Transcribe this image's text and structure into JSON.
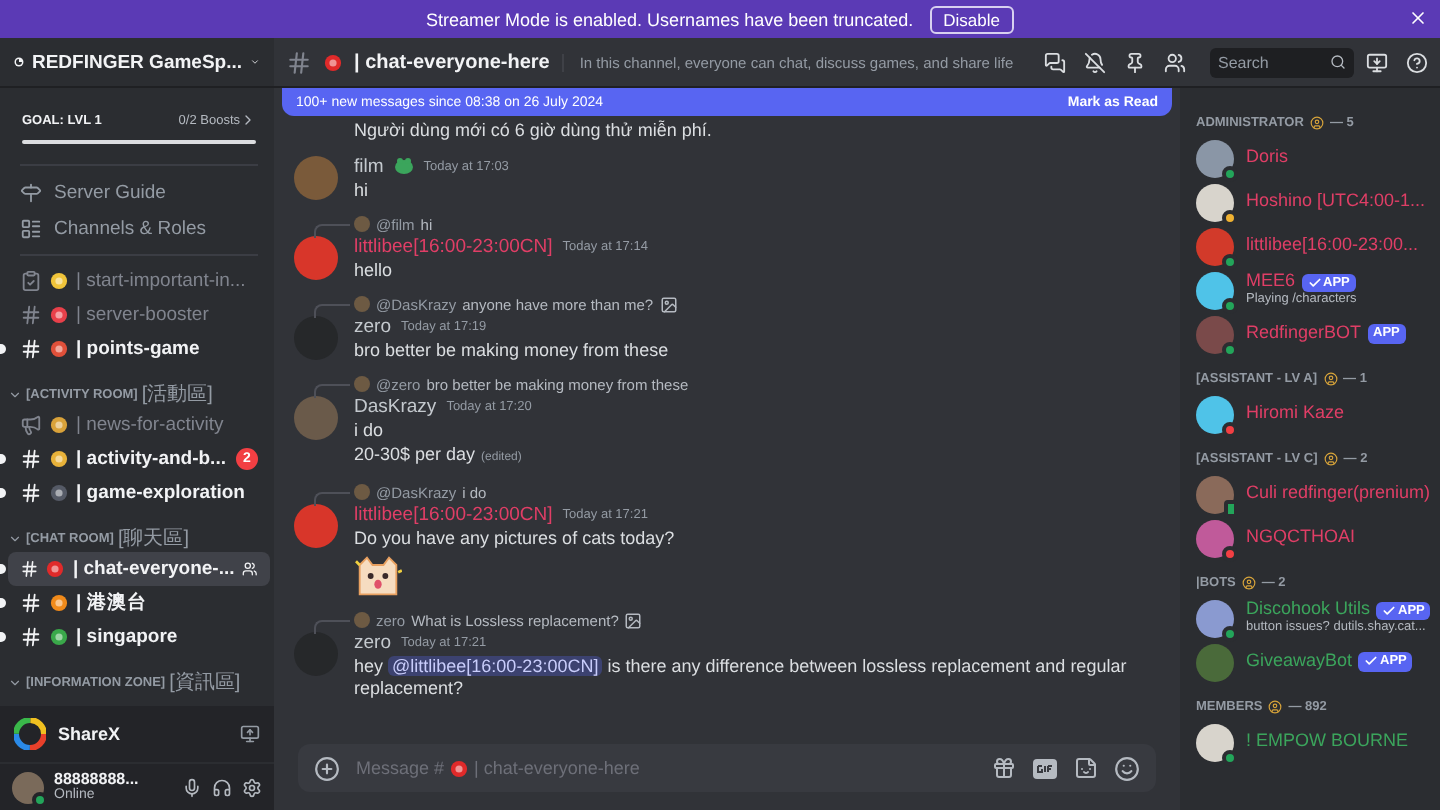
{
  "banner": {
    "text": "Streamer Mode is enabled. Usernames have been truncated.",
    "button": "Disable"
  },
  "server": {
    "name": "REDFINGER GameSp...",
    "goal": "GOAL: LVL 1",
    "boosts": "0/2 Boosts"
  },
  "nav": [
    "Server Guide",
    "Channels & Roles"
  ],
  "channels": [
    {
      "name": "| start-important-in...",
      "kind": "rules",
      "unread": false,
      "selected": false
    },
    {
      "name": "| server-booster",
      "kind": "text",
      "unread": false,
      "selected": false
    },
    {
      "name": "| points-game",
      "kind": "text",
      "unread": true,
      "selected": false
    }
  ],
  "categories": [
    {
      "name": "[ACTIVITY ROOM]",
      "name_cjk": "[活動區]",
      "expanded": true,
      "channels": [
        {
          "name": "| news-for-activity",
          "kind": "announcement",
          "unread": false,
          "selected": false
        },
        {
          "name": "| activity-and-b...",
          "kind": "text",
          "unread": true,
          "selected": false,
          "badge": "2"
        },
        {
          "name": "| game-exploration",
          "kind": "text",
          "unread": true,
          "selected": false
        }
      ]
    },
    {
      "name": "[CHAT ROOM]",
      "name_cjk": "[聊天區]",
      "expanded": true,
      "channels": [
        {
          "name": "| chat-everyone-...",
          "kind": "text",
          "unread": true,
          "selected": true
        },
        {
          "name": "| 港澳台",
          "kind": "text",
          "unread": true,
          "selected": false
        },
        {
          "name": "| singapore",
          "kind": "text",
          "unread": true,
          "selected": false
        }
      ]
    },
    {
      "name": "[INFORMATION ZONE]",
      "name_cjk": "[資訊區]",
      "expanded": true
    }
  ],
  "activity": {
    "name": "ShareX"
  },
  "user": {
    "name": "88888888...",
    "status": "Online"
  },
  "header": {
    "channel": "| chat-everyone-here",
    "topic": "In this channel, everyone can chat, discuss games, and share life",
    "search": {
      "placeholder": "Search"
    }
  },
  "new_messages": {
    "text": "100+ new messages since 08:38 on 26 July 2024",
    "action": "Mark as Read"
  },
  "messages": [
    {
      "kind": "continuation",
      "lines": [
        "Người dùng mới có 6 giờ dùng thử miễn phí."
      ]
    },
    {
      "kind": "message",
      "author": "film",
      "color": "#c4c9ce",
      "role_icon": true,
      "time": "Today at 17:03",
      "lines": [
        "hi"
      ]
    },
    {
      "kind": "message",
      "reply": {
        "author": "@film",
        "text": "hi",
        "attachment": false
      },
      "author": "littlibee[16:00-23:00CN]",
      "color": "#e03e66",
      "time": "Today at 17:14",
      "lines": [
        "hello"
      ]
    },
    {
      "kind": "message",
      "reply": {
        "author": "@DasKrazy",
        "text": "anyone have more than me?",
        "attachment": true
      },
      "author": "zero",
      "color": "#c4c9ce",
      "time": "Today at 17:19",
      "lines": [
        "bro better be making money from these"
      ]
    },
    {
      "kind": "message",
      "reply": {
        "author": "@zero",
        "text": "bro better be making money from these",
        "attachment": false
      },
      "author": "DasKrazy",
      "color": "#c4c9ce",
      "time": "Today at 17:20",
      "lines": [
        "i do",
        "20-30$ per day"
      ],
      "edited": "(edited)"
    },
    {
      "kind": "message",
      "reply": {
        "author": "@DasKrazy",
        "text": "i do",
        "attachment": false
      },
      "author": "littlibee[16:00-23:00CN]",
      "color": "#e03e66",
      "time": "Today at 17:21",
      "lines": [
        "Do you have any pictures of cats today?"
      ],
      "sticker": true
    },
    {
      "kind": "message",
      "reply": {
        "author": "zero",
        "text": "What is Lossless replacement?",
        "attachment": true
      },
      "author": "zero",
      "color": "#c4c9ce",
      "time": "Today at 17:21",
      "lines": [
        {
          "before": "hey ",
          "mention": "@littlibee[16:00-23:00CN]",
          "after": " is there any difference between lossless replacement and regular replacement?"
        }
      ]
    }
  ],
  "composer": {
    "placeholder_start": "Message #",
    "placeholder_end": "| chat-everyone-here"
  },
  "member_groups": [
    {
      "title": "ADMINISTRATOR",
      "count": "— 5",
      "members": [
        {
          "name": "Doris",
          "color": "#e03e66",
          "kind": "online"
        },
        {
          "name": "Hoshino [UTC4:00-1...",
          "color": "#e03e66",
          "kind": "idle"
        },
        {
          "name": "littlibee[16:00-23:00...",
          "color": "#e03e66",
          "kind": "online"
        },
        {
          "name": "MEE6",
          "color": "#e03e66",
          "kind": "online",
          "app": "APP",
          "verified": true,
          "activity": "Playing /characters"
        },
        {
          "name": "RedfingerBOT",
          "color": "#e03e66",
          "kind": "online",
          "app": "APP",
          "verified": false
        }
      ]
    },
    {
      "title": "[ASSISTANT - LV A]",
      "count": "— 1",
      "members": [
        {
          "name": "Hiromi Kaze",
          "color": "#e03e66",
          "kind": "dnd"
        }
      ]
    },
    {
      "title": "[ASSISTANT - LV C]",
      "count": "— 2",
      "members": [
        {
          "name": "Culi redfinger(prenium)",
          "color": "#e03e66",
          "kind": "mobile"
        },
        {
          "name": "NGQCTHOAI",
          "color": "#e03e66",
          "kind": "dnd"
        }
      ]
    },
    {
      "title": "|BOTS",
      "count": "— 2",
      "members": [
        {
          "name": "Discohook Utils",
          "color": "#3ba55c",
          "kind": "online",
          "app": "APP",
          "verified": true,
          "activity": "button issues? dutils.shay.cat..."
        },
        {
          "name": "GiveawayBot",
          "color": "#3ba55c",
          "kind": "offline",
          "app": "APP",
          "verified": true
        }
      ]
    },
    {
      "title": "MEMBERS",
      "count": "— 892",
      "members": [
        {
          "name": "! EMPOW BOURNE",
          "color": "#3ba55c",
          "kind": "online"
        }
      ]
    }
  ]
}
